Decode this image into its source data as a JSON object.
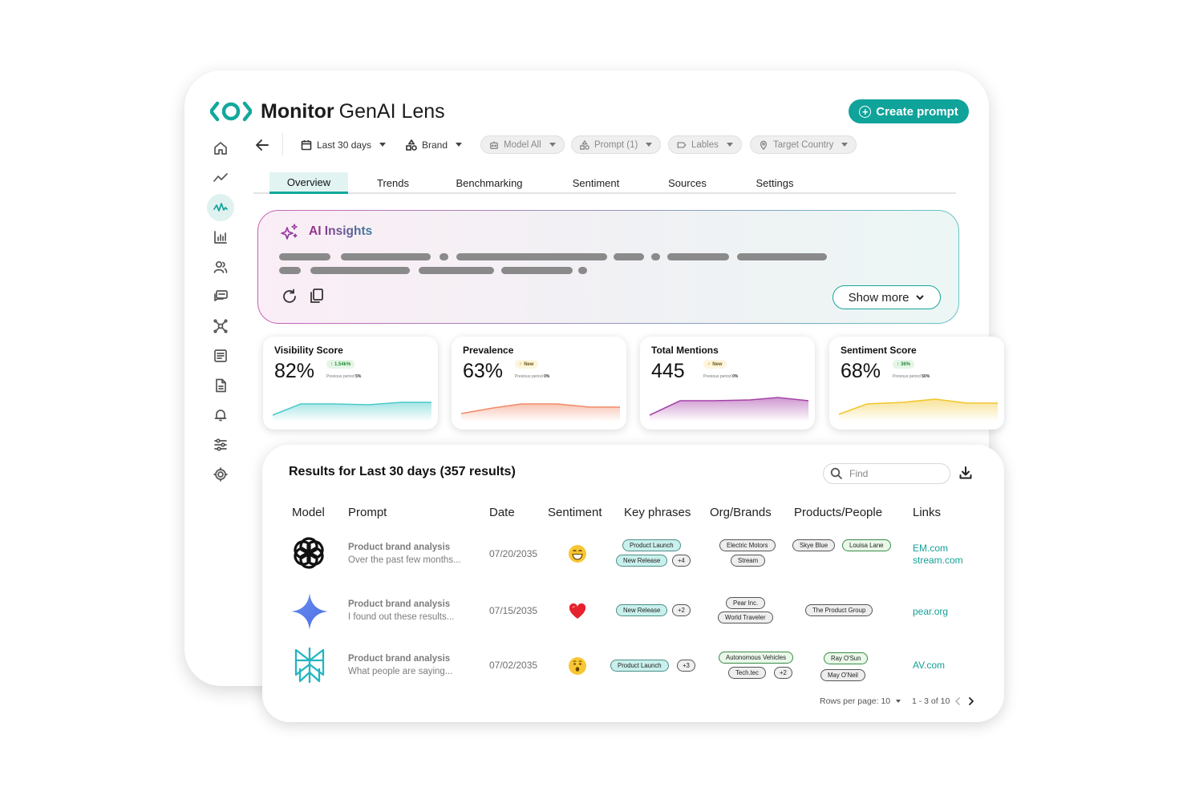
{
  "app": {
    "brand_bold": "Monitor",
    "brand_light": "GenAI Lens",
    "create_label": "Create prompt"
  },
  "colors": {
    "accent": "#0fa39a",
    "visibility": "#4cc9c9",
    "prevalence": "#f08a68",
    "mentions": "#a642a8",
    "sentiment": "#f1c62d"
  },
  "sidebar": {
    "items": [
      {
        "icon": "home-icon"
      },
      {
        "icon": "trend-line-icon"
      },
      {
        "icon": "pulse-icon",
        "active": true
      },
      {
        "icon": "bar-chart-icon"
      },
      {
        "icon": "users-icon"
      },
      {
        "icon": "chat-icon"
      },
      {
        "icon": "network-icon"
      },
      {
        "icon": "report-icon"
      },
      {
        "icon": "document-icon"
      },
      {
        "icon": "bell-icon"
      },
      {
        "icon": "sliders-icon"
      },
      {
        "icon": "gear-icon"
      }
    ]
  },
  "filters": {
    "date": "Last 30 days",
    "brand": "Brand",
    "model": "Model All",
    "prompt": "Prompt (1)",
    "labels": "Lables",
    "country": "Target Country"
  },
  "tabs": [
    "Overview",
    "Trends",
    "Benchmarking",
    "Sentiment",
    "Sources",
    "Settings"
  ],
  "insights": {
    "title": "AI Insights",
    "show_more": "Show more"
  },
  "kpis": [
    {
      "title": "Visibility Score",
      "value": "82%",
      "badge": "1.54k%",
      "badge_type": "up",
      "prev_label": "Previous period",
      "prev_value": "5%"
    },
    {
      "title": "Prevalence",
      "value": "63%",
      "badge": "New",
      "badge_type": "new",
      "prev_label": "Previous period",
      "prev_value": "0%"
    },
    {
      "title": "Total Mentions",
      "value": "445",
      "badge": "New",
      "badge_type": "new",
      "prev_label": "Previous period",
      "prev_value": "0%"
    },
    {
      "title": "Sentiment Score",
      "value": "68%",
      "badge": "36%",
      "badge_type": "up",
      "prev_label": "Previous period",
      "prev_value": "50%"
    }
  ],
  "results": {
    "title": "Results for Last 30 days (357 results)",
    "find_placeholder": "Find",
    "columns": [
      "Model",
      "Prompt",
      "Date",
      "Sentiment",
      "Key phrases",
      "Org/Brands",
      "Products/People",
      "Links"
    ],
    "rows": [
      {
        "model_icon": "openai-logo-icon",
        "prompt_title": "Product brand analysis",
        "prompt_sub": "Over the past few months...",
        "date": "07/20/2035",
        "sentiment_icon": "grin-emoji-icon",
        "key_phrases": [
          "Product Launch",
          "New Release"
        ],
        "key_more": "+4",
        "orgs": [
          "Electric Motors",
          "Stream"
        ],
        "people": [
          "Skye Blue",
          "Louisa Lane"
        ],
        "links": [
          "EM.com",
          "stream.com"
        ]
      },
      {
        "model_icon": "gemini-star-icon",
        "prompt_title": "Product brand analysis",
        "prompt_sub": "I found out these results...",
        "date": "07/15/2035",
        "sentiment_icon": "heart-emoji-icon",
        "key_phrases": [
          "New Release"
        ],
        "key_more": "+2",
        "orgs": [
          "Pear Inc.",
          "World Traveler"
        ],
        "people": [
          "The Product Group"
        ],
        "links": [
          "pear.org"
        ]
      },
      {
        "model_icon": "perplexity-logo-icon",
        "prompt_title": "Product brand analysis",
        "prompt_sub": "What people are saying...",
        "date": "07/02/2035",
        "sentiment_icon": "surprised-emoji-icon",
        "key_phrases": [
          "Product Launch"
        ],
        "key_more": "+3",
        "orgs": [
          "Autonomous Vehicles",
          "Tech.tec"
        ],
        "orgs_more": "+2",
        "people": [
          "Ray O'Sun",
          "May O'Neil"
        ],
        "links": [
          "AV.com"
        ]
      }
    ],
    "pagination": {
      "rows_per_page_label": "Rows per page: 10",
      "range": "1 - 3 of 10"
    }
  }
}
